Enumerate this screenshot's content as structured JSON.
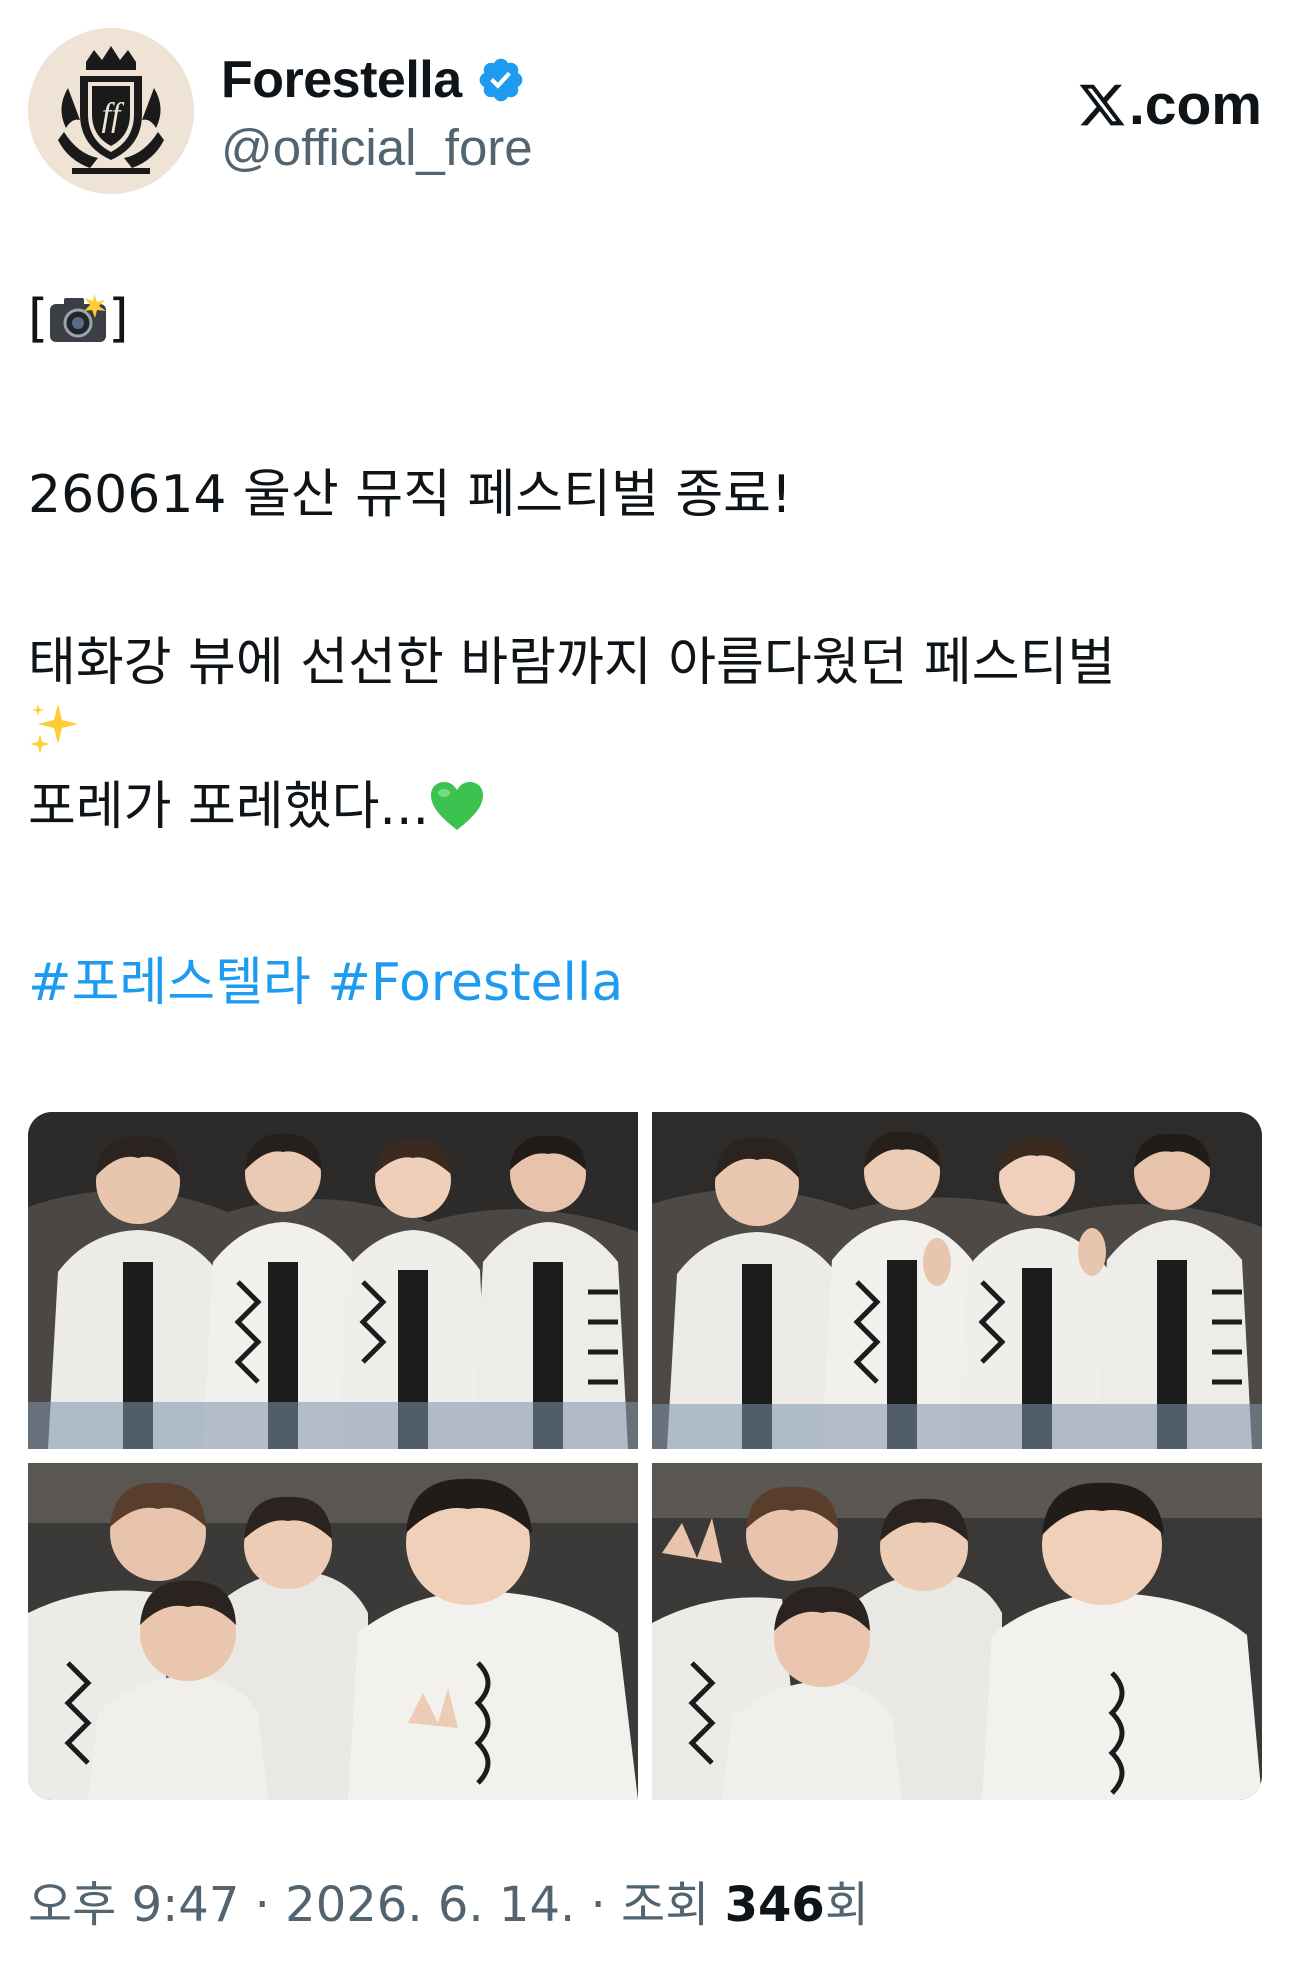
{
  "author": {
    "display_name": "Forestella",
    "handle": "@official_fore",
    "verified": true,
    "avatar_icon": "crest-logo-icon"
  },
  "site": {
    "label": ".com",
    "icon": "x-logo-icon"
  },
  "tweet": {
    "line1": "[",
    "line1_emoji": "camera-with-flash-icon",
    "line1_end": "]",
    "line2": "260614 울산 뮤직 페스티벌 종료!",
    "line3": "태화강 뷰에 선선한 바람까지 아름다웠던 페스티벌",
    "line3_emoji": "sparkles-icon",
    "line4": "포레가 포레했다...",
    "line4_emoji": "green-heart-icon",
    "hashtags": [
      "#포레스텔라",
      "#Forestella"
    ]
  },
  "media": {
    "count": 4,
    "photos": [
      "group-photo-1",
      "group-photo-2",
      "selfie-photo-1",
      "selfie-photo-2"
    ]
  },
  "meta": {
    "time": "오후 9:47",
    "date": "2026. 6. 14.",
    "views_label": "조회",
    "views_count": "346",
    "views_suffix": "회",
    "separator": "·"
  },
  "colors": {
    "link": "#1d9bf0",
    "secondary_text": "#536471",
    "verified_badge": "#1d9bf0"
  }
}
